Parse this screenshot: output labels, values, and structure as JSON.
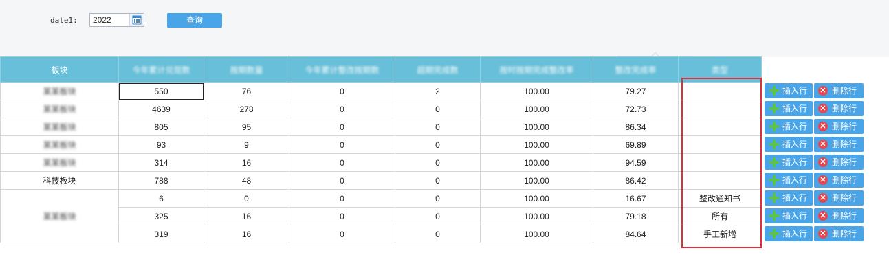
{
  "filter": {
    "date_label": "date1:",
    "date_value": "2022",
    "query_label": "查询"
  },
  "table": {
    "headers": [
      "板块",
      "今年累计兑现数",
      "按期数量",
      "今年累计整改按期数",
      "超期完成数",
      "按时按期完成整改率",
      "整改完成率",
      "类型"
    ],
    "rows": [
      {
        "board": "某某板块",
        "c1": "550",
        "c2": "76",
        "c3": "0",
        "c4": "2",
        "c5": "100.00",
        "c6": "79.27",
        "type": ""
      },
      {
        "board": "某某板块",
        "c1": "4639",
        "c2": "278",
        "c3": "0",
        "c4": "0",
        "c5": "100.00",
        "c6": "72.73",
        "type": ""
      },
      {
        "board": "某某板块",
        "c1": "805",
        "c2": "95",
        "c3": "0",
        "c4": "0",
        "c5": "100.00",
        "c6": "86.34",
        "type": ""
      },
      {
        "board": "某某板块",
        "c1": "93",
        "c2": "9",
        "c3": "0",
        "c4": "0",
        "c5": "100.00",
        "c6": "69.89",
        "type": ""
      },
      {
        "board": "某某板块",
        "c1": "314",
        "c2": "16",
        "c3": "0",
        "c4": "0",
        "c5": "100.00",
        "c6": "94.59",
        "type": ""
      },
      {
        "board": "科技板块",
        "c1": "788",
        "c2": "48",
        "c3": "0",
        "c4": "0",
        "c5": "100.00",
        "c6": "86.42",
        "type": ""
      },
      {
        "board": "",
        "c1": "6",
        "c2": "0",
        "c3": "0",
        "c4": "0",
        "c5": "100.00",
        "c6": "16.67",
        "type": "整改通知书"
      },
      {
        "board": "",
        "c1": "325",
        "c2": "16",
        "c3": "0",
        "c4": "0",
        "c5": "100.00",
        "c6": "79.18",
        "type": "所有"
      },
      {
        "board": "",
        "c1": "319",
        "c2": "16",
        "c3": "0",
        "c4": "0",
        "c5": "100.00",
        "c6": "84.64",
        "type": "手工新增"
      }
    ],
    "merged_board_label": "某某板块"
  },
  "actions": {
    "insert_label": "插入行",
    "delete_label": "删除行",
    "count": 9
  },
  "colors": {
    "header_bg": "#67bfd9",
    "button_bg": "#4aa5e8",
    "highlight_border": "#d8313b"
  }
}
